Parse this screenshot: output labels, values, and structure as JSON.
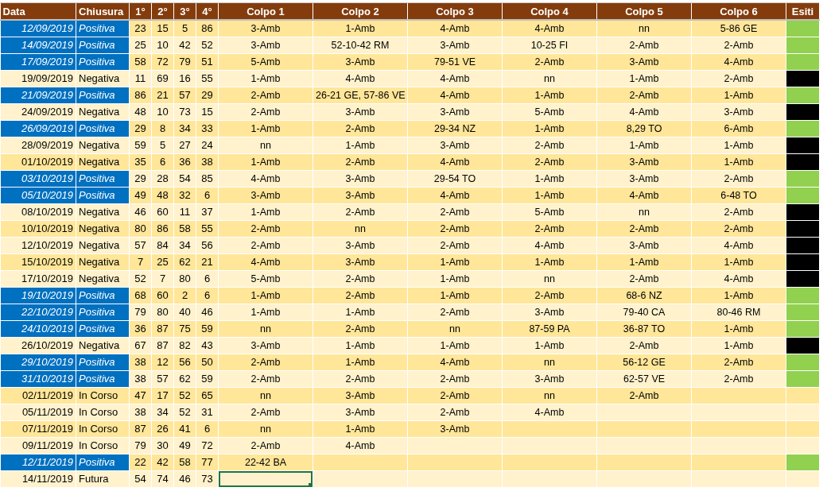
{
  "columns": [
    "Data",
    "Chiusura",
    "1°",
    "2°",
    "3°",
    "4°",
    "Colpo 1",
    "Colpo 2",
    "Colpo 3",
    "Colpo 4",
    "Colpo 5",
    "Colpo 6",
    "Esiti"
  ],
  "rows": [
    {
      "date": "12/09/2019",
      "closure": "Positiva",
      "highlighted": true,
      "numbers": [
        "23",
        "15",
        "5",
        "86"
      ],
      "colpi": [
        "3-Amb",
        "1-Amb",
        "4-Amb",
        "4-Amb",
        "nn",
        "5-86 GE"
      ],
      "color": "#92d050",
      "selected": false
    },
    {
      "date": "14/09/2019",
      "closure": "Positiva",
      "highlighted": true,
      "numbers": [
        "25",
        "10",
        "42",
        "52"
      ],
      "colpi": [
        "3-Amb",
        "52-10-42 RM",
        "3-Amb",
        "10-25 FI",
        "2-Amb",
        "2-Amb"
      ],
      "color": "#92d050",
      "selected": false
    },
    {
      "date": "17/09/2019",
      "closure": "Positiva",
      "highlighted": true,
      "numbers": [
        "58",
        "72",
        "79",
        "51"
      ],
      "colpi": [
        "5-Amb",
        "3-Amb",
        "79-51 VE",
        "2-Amb",
        "3-Amb",
        "4-Amb"
      ],
      "color": "#92d050",
      "selected": false
    },
    {
      "date": "19/09/2019",
      "closure": "Negativa",
      "highlighted": false,
      "numbers": [
        "11",
        "69",
        "16",
        "55"
      ],
      "colpi": [
        "1-Amb",
        "4-Amb",
        "4-Amb",
        "nn",
        "1-Amb",
        "2-Amb"
      ],
      "color": "#000000",
      "selected": false
    },
    {
      "date": "21/09/2019",
      "closure": "Positiva",
      "highlighted": true,
      "numbers": [
        "86",
        "21",
        "57",
        "29"
      ],
      "colpi": [
        "2-Amb",
        "26-21 GE, 57-86 VE",
        "4-Amb",
        "1-Amb",
        "2-Amb",
        "1-Amb"
      ],
      "color": "#92d050",
      "selected": false
    },
    {
      "date": "24/09/2019",
      "closure": "Negativa",
      "highlighted": false,
      "numbers": [
        "48",
        "10",
        "73",
        "15"
      ],
      "colpi": [
        "2-Amb",
        "3-Amb",
        "3-Amb",
        "5-Amb",
        "4-Amb",
        "3-Amb"
      ],
      "color": "#000000",
      "selected": false
    },
    {
      "date": "26/09/2019",
      "closure": "Positiva",
      "highlighted": true,
      "numbers": [
        "29",
        "8",
        "34",
        "33"
      ],
      "colpi": [
        "1-Amb",
        "2-Amb",
        "29-34 NZ",
        "1-Amb",
        "8,29 TO",
        "6-Amb"
      ],
      "color": "#92d050",
      "selected": false
    },
    {
      "date": "28/09/2019",
      "closure": "Negativa",
      "highlighted": false,
      "numbers": [
        "59",
        "5",
        "27",
        "24"
      ],
      "colpi": [
        "nn",
        "1-Amb",
        "3-Amb",
        "2-Amb",
        "1-Amb",
        "1-Amb"
      ],
      "color": "#000000",
      "selected": false
    },
    {
      "date": "01/10/2019",
      "closure": "Negativa",
      "highlighted": false,
      "numbers": [
        "35",
        "6",
        "36",
        "38"
      ],
      "colpi": [
        "1-Amb",
        "2-Amb",
        "4-Amb",
        "2-Amb",
        "3-Amb",
        "1-Amb"
      ],
      "color": "#000000",
      "selected": false
    },
    {
      "date": "03/10/2019",
      "closure": "Positiva",
      "highlighted": true,
      "numbers": [
        "29",
        "28",
        "54",
        "85"
      ],
      "colpi": [
        "4-Amb",
        "3-Amb",
        "29-54 TO",
        "1-Amb",
        "3-Amb",
        "2-Amb"
      ],
      "color": "#92d050",
      "selected": false
    },
    {
      "date": "05/10/2019",
      "closure": "Positiva",
      "highlighted": true,
      "numbers": [
        "49",
        "48",
        "32",
        "6"
      ],
      "colpi": [
        "3-Amb",
        "3-Amb",
        "4-Amb",
        "1-Amb",
        "4-Amb",
        "6-48 TO"
      ],
      "color": "#92d050",
      "selected": false
    },
    {
      "date": "08/10/2019",
      "closure": "Negativa",
      "highlighted": false,
      "numbers": [
        "46",
        "60",
        "11",
        "37"
      ],
      "colpi": [
        "1-Amb",
        "2-Amb",
        "2-Amb",
        "5-Amb",
        "nn",
        "2-Amb"
      ],
      "color": "#000000",
      "selected": false
    },
    {
      "date": "10/10/2019",
      "closure": "Negativa",
      "highlighted": false,
      "numbers": [
        "80",
        "86",
        "58",
        "55"
      ],
      "colpi": [
        "2-Amb",
        "nn",
        "2-Amb",
        "2-Amb",
        "2-Amb",
        "2-Amb"
      ],
      "color": "#000000",
      "selected": false
    },
    {
      "date": "12/10/2019",
      "closure": "Negativa",
      "highlighted": false,
      "numbers": [
        "57",
        "84",
        "34",
        "56"
      ],
      "colpi": [
        "2-Amb",
        "3-Amb",
        "2-Amb",
        "4-Amb",
        "3-Amb",
        "4-Amb"
      ],
      "color": "#000000",
      "selected": false
    },
    {
      "date": "15/10/2019",
      "closure": "Negativa",
      "highlighted": false,
      "numbers": [
        "7",
        "25",
        "62",
        "21"
      ],
      "colpi": [
        "4-Amb",
        "3-Amb",
        "1-Amb",
        "1-Amb",
        "1-Amb",
        "1-Amb"
      ],
      "color": "#000000",
      "selected": false
    },
    {
      "date": "17/10/2019",
      "closure": "Negativa",
      "highlighted": false,
      "numbers": [
        "52",
        "7",
        "80",
        "6"
      ],
      "colpi": [
        "5-Amb",
        "2-Amb",
        "1-Amb",
        "nn",
        "2-Amb",
        "4-Amb"
      ],
      "color": "#000000",
      "selected": false
    },
    {
      "date": "19/10/2019",
      "closure": "Positiva",
      "highlighted": true,
      "numbers": [
        "68",
        "60",
        "2",
        "6"
      ],
      "colpi": [
        "1-Amb",
        "2-Amb",
        "1-Amb",
        "2-Amb",
        "68-6 NZ",
        "1-Amb"
      ],
      "color": "#92d050",
      "selected": false
    },
    {
      "date": "22/10/2019",
      "closure": "Positiva",
      "highlighted": true,
      "numbers": [
        "79",
        "80",
        "40",
        "46"
      ],
      "colpi": [
        "1-Amb",
        "1-Amb",
        "2-Amb",
        "3-Amb",
        "79-40 CA",
        "80-46 RM"
      ],
      "color": "#92d050",
      "selected": false
    },
    {
      "date": "24/10/2019",
      "closure": "Positiva",
      "highlighted": true,
      "numbers": [
        "36",
        "87",
        "75",
        "59"
      ],
      "colpi": [
        "nn",
        "2-Amb",
        "nn",
        "87-59 PA",
        "36-87 TO",
        "1-Amb"
      ],
      "color": "#92d050",
      "selected": false
    },
    {
      "date": "26/10/2019",
      "closure": "Negativa",
      "highlighted": false,
      "numbers": [
        "67",
        "87",
        "82",
        "43"
      ],
      "colpi": [
        "3-Amb",
        "1-Amb",
        "1-Amb",
        "1-Amb",
        "2-Amb",
        "1-Amb"
      ],
      "color": "#000000",
      "selected": false
    },
    {
      "date": "29/10/2019",
      "closure": "Positiva",
      "highlighted": true,
      "numbers": [
        "38",
        "12",
        "56",
        "50"
      ],
      "colpi": [
        "2-Amb",
        "1-Amb",
        "4-Amb",
        "nn",
        "56-12 GE",
        "2-Amb"
      ],
      "color": "#92d050",
      "selected": false
    },
    {
      "date": "31/10/2019",
      "closure": "Positiva",
      "highlighted": true,
      "numbers": [
        "38",
        "57",
        "62",
        "59"
      ],
      "colpi": [
        "2-Amb",
        "2-Amb",
        "2-Amb",
        "3-Amb",
        "62-57 VE",
        "2-Amb"
      ],
      "color": "#92d050",
      "selected": false
    },
    {
      "date": "02/11/2019",
      "closure": "In Corso",
      "highlighted": false,
      "numbers": [
        "47",
        "17",
        "52",
        "65"
      ],
      "colpi": [
        "nn",
        "3-Amb",
        "2-Amb",
        "nn",
        "2-Amb"
      ],
      "selected": false
    },
    {
      "date": "05/11/2019",
      "closure": "In Corso",
      "highlighted": false,
      "numbers": [
        "38",
        "34",
        "52",
        "31"
      ],
      "colpi": [
        "2-Amb",
        "3-Amb",
        "2-Amb",
        "4-Amb"
      ],
      "selected": false
    },
    {
      "date": "07/11/2019",
      "closure": "In Corso",
      "highlighted": false,
      "numbers": [
        "87",
        "26",
        "41",
        "6"
      ],
      "colpi": [
        "nn",
        "1-Amb",
        "3-Amb"
      ],
      "selected": false
    },
    {
      "date": "09/11/2019",
      "closure": "In Corso",
      "highlighted": false,
      "numbers": [
        "79",
        "30",
        "49",
        "72"
      ],
      "colpi": [
        "2-Amb",
        "4-Amb"
      ],
      "selected": false
    },
    {
      "date": "12/11/2019",
      "closure": "Positiva",
      "highlighted": true,
      "numbers": [
        "22",
        "42",
        "58",
        "77"
      ],
      "colpi": [
        "22-42 BA"
      ],
      "color": "#92d050",
      "selected": false
    },
    {
      "date": "14/11/2019",
      "closure": "Futura",
      "highlighted": false,
      "numbers": [
        "54",
        "74",
        "46",
        "73"
      ],
      "colpi": [],
      "selected": true
    }
  ]
}
